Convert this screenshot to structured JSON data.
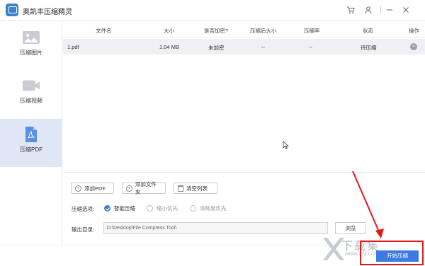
{
  "app": {
    "title": "奥凯丰压缩精灵"
  },
  "sidebar": {
    "items": [
      {
        "label": "压缩图片",
        "icon": "image-icon",
        "active": false
      },
      {
        "label": "压缩视频",
        "icon": "video-icon",
        "active": false
      },
      {
        "label": "压缩PDF",
        "icon": "pdf-icon",
        "active": true
      }
    ]
  },
  "table": {
    "headers": [
      "文件名",
      "大小",
      "是否加密?",
      "压缩后大小",
      "压缩率",
      "状态",
      "操作"
    ],
    "rows": [
      {
        "name": "1.pdf",
        "size": "1.04 MB",
        "encrypted": "未加密",
        "compressed_size": "--",
        "ratio": "--",
        "status": "待压缩"
      }
    ]
  },
  "toolbar": {
    "add_pdf": "添加PDF",
    "add_folder": "添加文件夹",
    "clear_list": "清空列表"
  },
  "options": {
    "label": "压缩选项:",
    "choices": [
      {
        "label": "智能压缩",
        "checked": true
      },
      {
        "label": "缩小优先",
        "checked": false
      },
      {
        "label": "清晰度优先",
        "checked": false
      }
    ]
  },
  "output": {
    "label": "输出目录:",
    "path": "D:\\Desktop\\File Compress Tool\\",
    "browse": "浏览"
  },
  "footer": {
    "start": "开始压缩"
  },
  "watermark": {
    "text": "下载集",
    "sub": "www.xzji.com"
  },
  "colors": {
    "accent": "#3d7be0",
    "active_side": "#dfe7f6",
    "highlight": "#e21a1a"
  }
}
